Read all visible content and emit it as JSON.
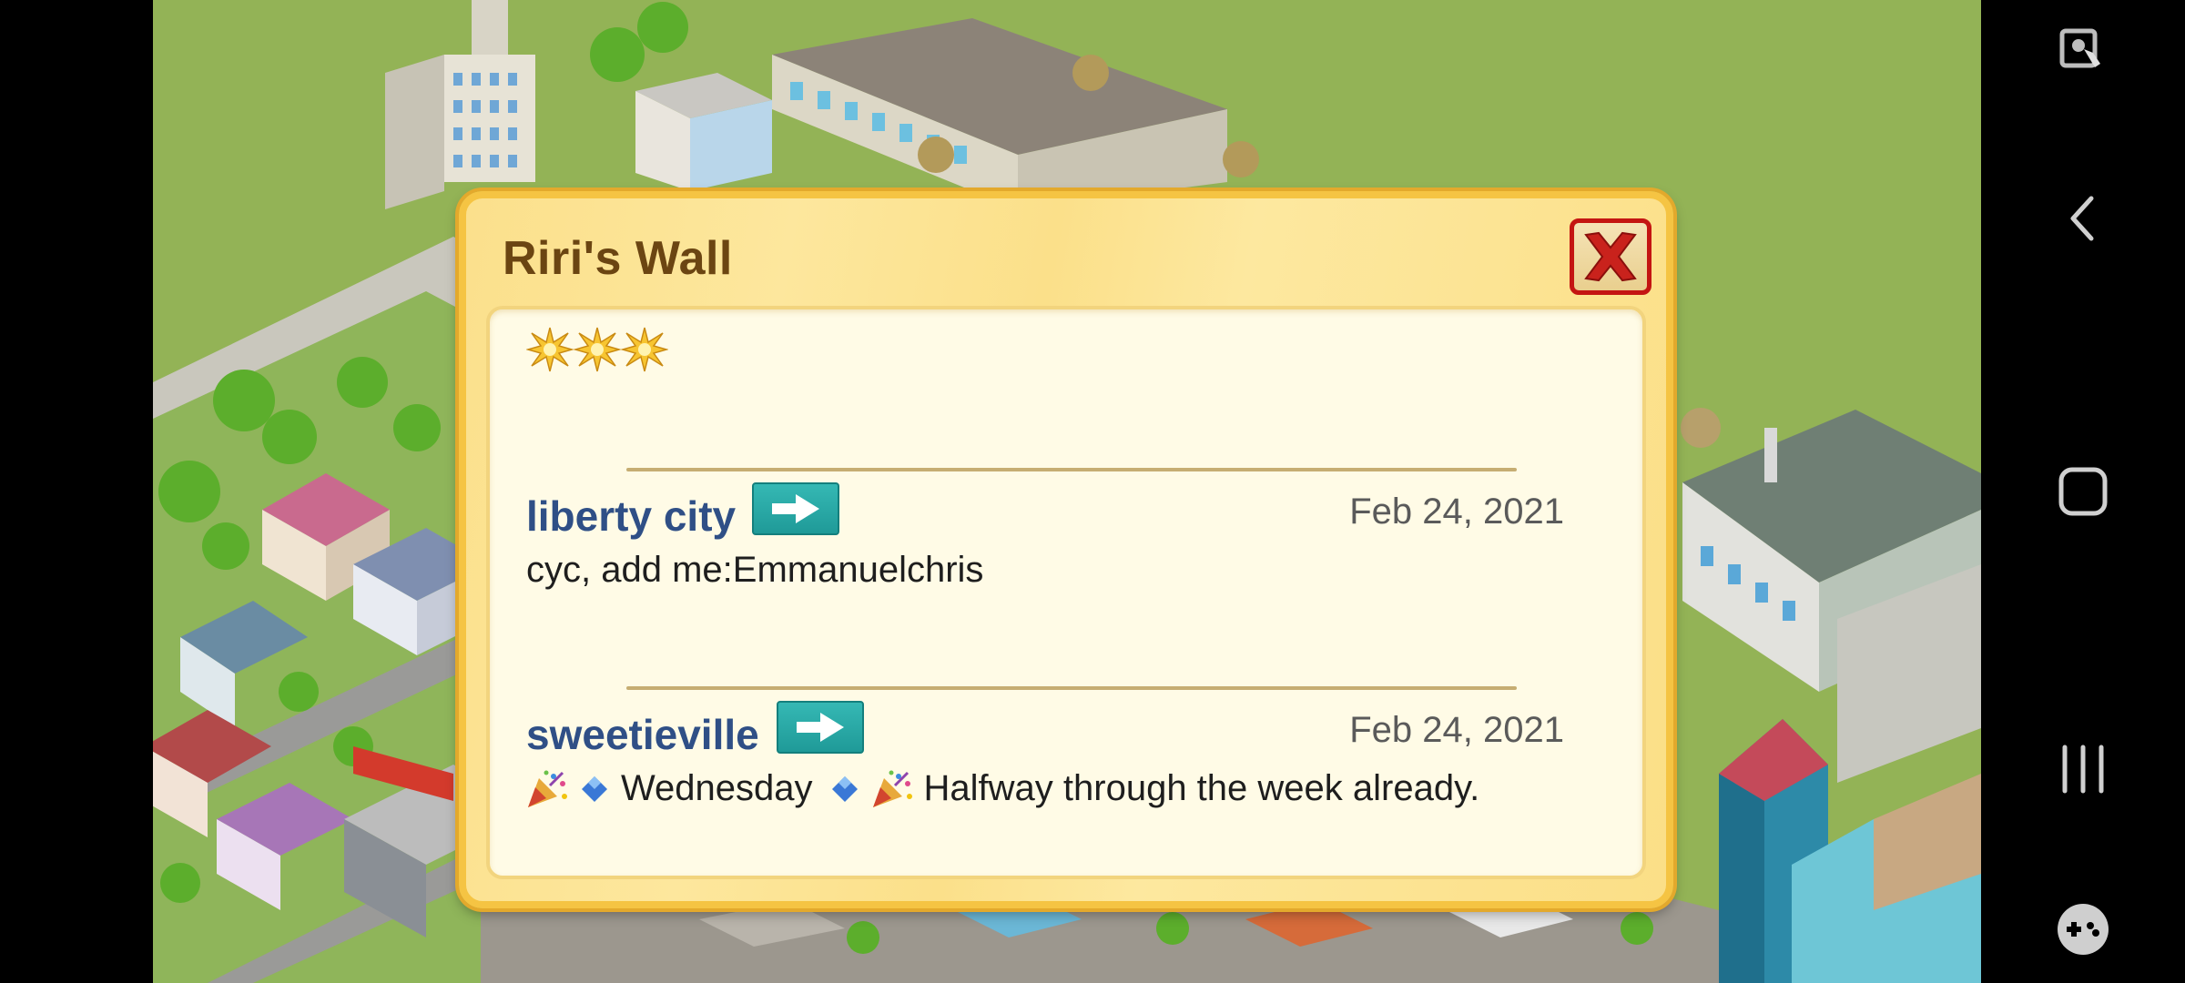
{
  "dialog": {
    "title": "Riri's Wall",
    "star_count": 3
  },
  "posts": [
    {
      "user": "liberty city",
      "date": "Feb 24, 2021",
      "message": "cyc, add me:Emmanuelchris"
    },
    {
      "user": "sweetieville",
      "date": "Feb 24, 2021",
      "message_parts": [
        "Wednesday",
        "Halfway through the week already."
      ]
    }
  ],
  "icons": {
    "close": "close-icon",
    "visit": "arrow-right-icon",
    "star": "star-icon",
    "party": "party-popper-icon",
    "diamond": "blue-diamond-icon"
  },
  "navbar": {
    "items": [
      "screen-touch-icon",
      "back-icon",
      "home-icon",
      "recents-icon",
      "game-controller-icon"
    ]
  },
  "colors": {
    "dialog_border": "#f5c443",
    "title": "#6b4512",
    "username": "#2f4f86",
    "close_red": "#c41512",
    "visit_teal": "#1f9a98"
  }
}
